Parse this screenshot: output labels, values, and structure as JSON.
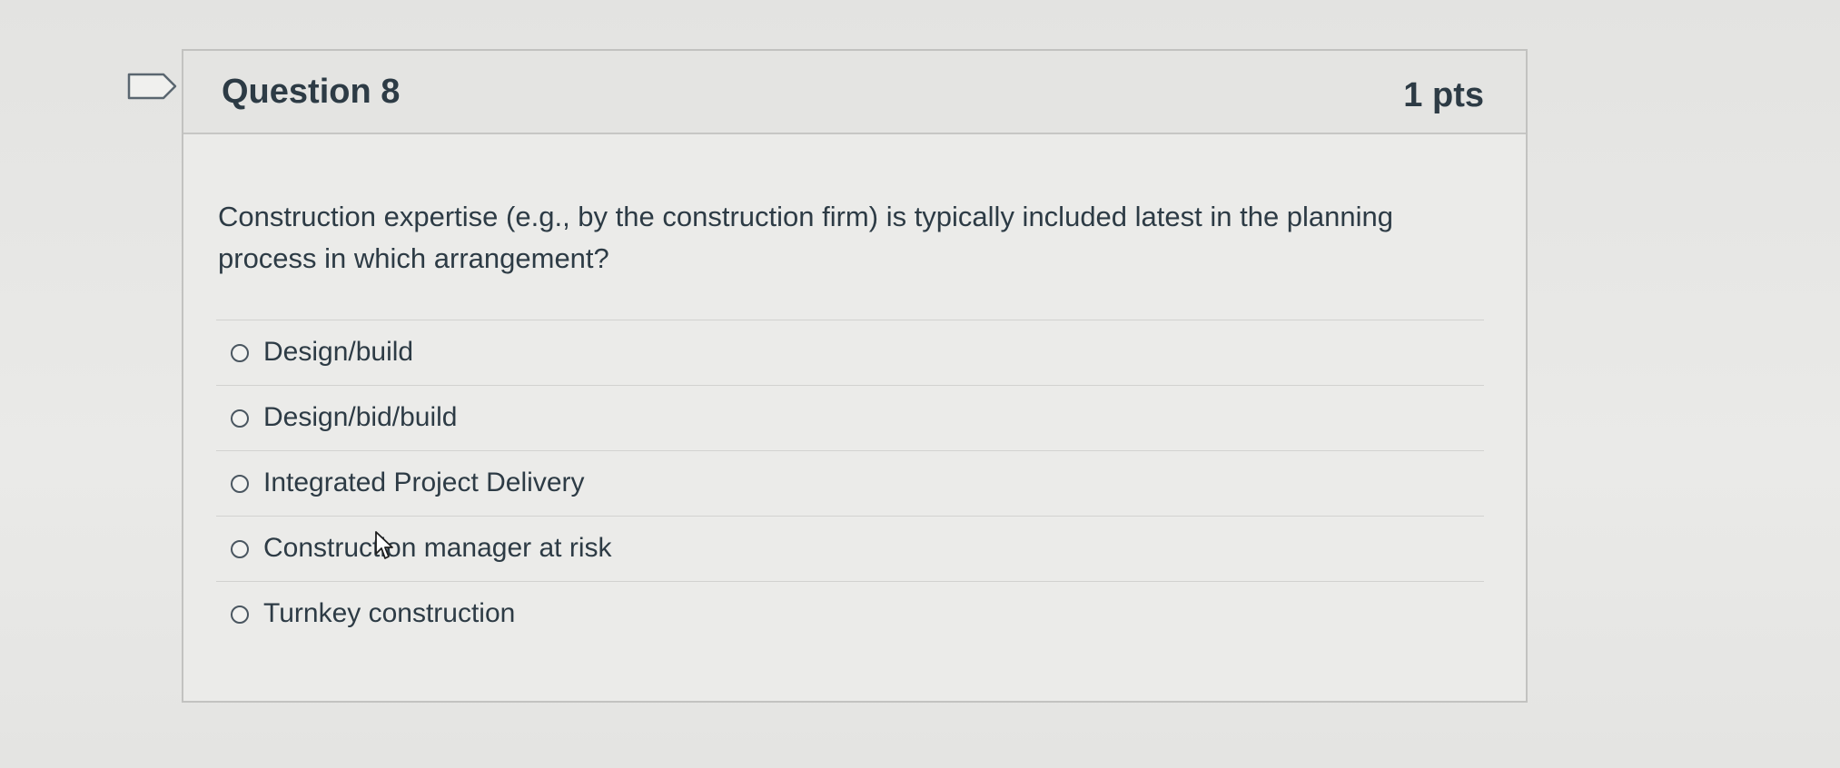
{
  "question": {
    "title": "Question 8",
    "points": "1 pts",
    "text": "Construction expertise (e.g., by the construction firm) is typically included latest in the planning process in which arrangement?"
  },
  "answers": [
    {
      "label": "Design/build",
      "selected": false
    },
    {
      "label": "Design/bid/build",
      "selected": false
    },
    {
      "label": "Integrated Project Delivery",
      "selected": false
    },
    {
      "label": "Construction manager at risk",
      "selected": false
    },
    {
      "label": "Turnkey construction",
      "selected": false
    }
  ],
  "icons": {
    "flag": "bookmark-flag-icon",
    "cursor": "mouse-pointer-icon",
    "radio": "radio-unchecked-icon"
  },
  "colors": {
    "text": "#2d3b45",
    "border": "#c2c2c0",
    "header_bg": "#e4e4e2"
  }
}
